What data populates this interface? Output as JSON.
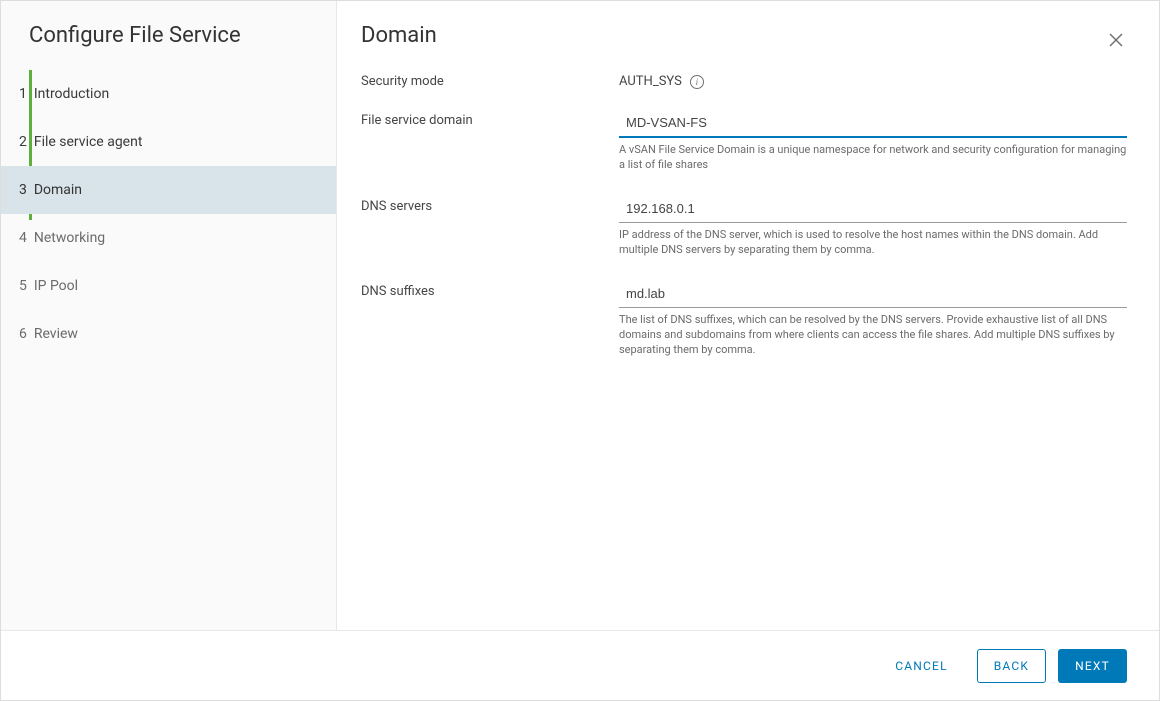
{
  "sidebar": {
    "title": "Configure File Service",
    "steps": [
      {
        "num": "1",
        "label": "Introduction"
      },
      {
        "num": "2",
        "label": "File service agent"
      },
      {
        "num": "3",
        "label": "Domain"
      },
      {
        "num": "4",
        "label": "Networking"
      },
      {
        "num": "5",
        "label": "IP Pool"
      },
      {
        "num": "6",
        "label": "Review"
      }
    ]
  },
  "content": {
    "title": "Domain",
    "security_mode_label": "Security mode",
    "security_mode_value": "AUTH_SYS",
    "file_service_domain_label": "File service domain",
    "file_service_domain_value": "MD-VSAN-FS",
    "file_service_domain_help": "A vSAN File Service Domain is a unique namespace for network and security configuration for managing a list of file shares",
    "dns_servers_label": "DNS servers",
    "dns_servers_value": "192.168.0.1",
    "dns_servers_help": "IP address of the DNS server, which is used to resolve the host names within the DNS domain. Add multiple DNS servers by separating them by comma.",
    "dns_suffixes_label": "DNS suffixes",
    "dns_suffixes_value": "md.lab",
    "dns_suffixes_help": "The list of DNS suffixes, which can be resolved by the DNS servers. Provide exhaustive list of all DNS domains and subdomains from where clients can access the file shares. Add multiple DNS suffixes by separating them by comma."
  },
  "footer": {
    "cancel": "CANCEL",
    "back": "BACK",
    "next": "NEXT"
  }
}
